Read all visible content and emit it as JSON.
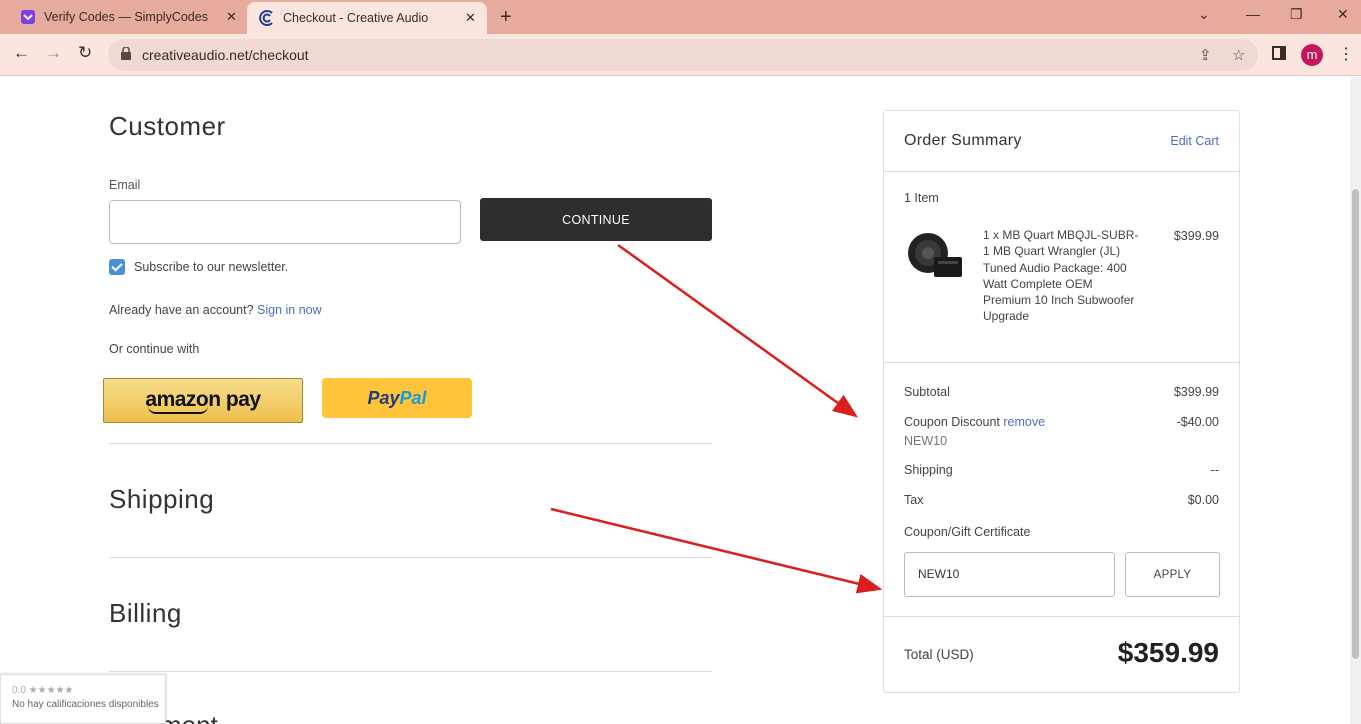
{
  "browser": {
    "tabs": [
      {
        "title": "Verify Codes — SimplyCodes",
        "active": false
      },
      {
        "title": "Checkout - Creative Audio",
        "active": true
      }
    ],
    "url": "creativeaudio.net/checkout",
    "profile_initial": "m"
  },
  "checkout": {
    "customer": {
      "heading": "Customer",
      "email_label": "Email",
      "email_value": "",
      "continue_label": "CONTINUE",
      "newsletter_label": "Subscribe to our newsletter.",
      "newsletter_checked": true,
      "account_prompt": "Already have an account?",
      "sign_in_label": "Sign in now",
      "continue_with": "Or continue with",
      "amazon_pay_label": "amazon pay",
      "paypal_label_1": "Pay",
      "paypal_label_2": "Pal"
    },
    "shipping_heading": "Shipping",
    "billing_heading": "Billing",
    "payment_heading_partial": "ment"
  },
  "summary": {
    "title": "Order Summary",
    "edit_cart": "Edit Cart",
    "item_count": "1 Item",
    "item": {
      "name": "1 x MB Quart MBQJL-SUBR-1 MB Quart Wrangler (JL) Tuned Audio Package: 400 Watt Complete OEM Premium 10 Inch Subwoofer Upgrade",
      "price": "$399.99"
    },
    "subtotal_label": "Subtotal",
    "subtotal_value": "$399.99",
    "coupon_label": "Coupon Discount",
    "coupon_remove": "remove",
    "coupon_code": "NEW10",
    "coupon_value": "-$40.00",
    "shipping_label": "Shipping",
    "shipping_value": "--",
    "tax_label": "Tax",
    "tax_value": "$0.00",
    "gift_label": "Coupon/Gift Certificate",
    "gift_input_value": "NEW10",
    "apply_label": "APPLY",
    "total_label": "Total (USD)",
    "total_value": "$359.99"
  },
  "rating_badge": {
    "score": "0.0 ★★★★★",
    "text": "No hay calificaciones disponibles"
  },
  "colors": {
    "tabbar": "#e6ab9c",
    "link": "#4a6fbe",
    "annotation_arrow": "#d9201f"
  }
}
